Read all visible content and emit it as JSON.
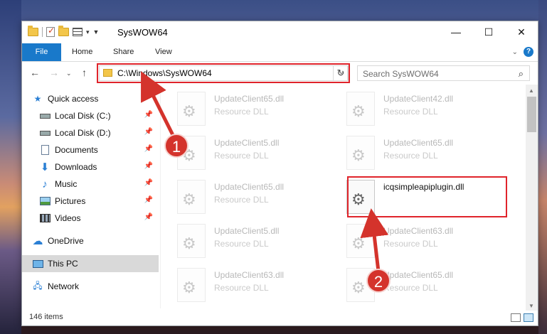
{
  "window": {
    "title": "SysWOW64",
    "minimize": "—",
    "maximize": "☐",
    "close": "✕"
  },
  "ribbon": {
    "tabs": [
      "File",
      "Home",
      "Share",
      "View"
    ],
    "expand_icon": "chevron-down-icon",
    "help": "?"
  },
  "address": {
    "path": "C:\\Windows\\SysWOW64",
    "search_placeholder": "Search SysWOW64"
  },
  "sidebar": {
    "items": [
      {
        "label": "Quick access",
        "icon": "star-icon"
      },
      {
        "label": "Local Disk (C:)",
        "icon": "drive-icon"
      },
      {
        "label": "Local Disk (D:)",
        "icon": "drive-icon"
      },
      {
        "label": "Documents",
        "icon": "documents-icon"
      },
      {
        "label": "Downloads",
        "icon": "downloads-icon"
      },
      {
        "label": "Music",
        "icon": "music-icon"
      },
      {
        "label": "Pictures",
        "icon": "pictures-icon"
      },
      {
        "label": "Videos",
        "icon": "videos-icon"
      },
      {
        "label": "OneDrive",
        "icon": "cloud-icon"
      },
      {
        "label": "This PC",
        "icon": "computer-icon"
      },
      {
        "label": "Network",
        "icon": "network-icon"
      }
    ]
  },
  "files": [
    {
      "name": "UpdateClient65.dll",
      "desc": "Resource DLL"
    },
    {
      "name": "UpdateClient42.dll",
      "desc": "Resource DLL"
    },
    {
      "name": "UpdateClient5.dll",
      "desc": "Resource DLL"
    },
    {
      "name": "UpdateClient65.dll",
      "desc": "Resource DLL"
    },
    {
      "name": "UpdateClient65.dll",
      "desc": "Resource DLL"
    },
    {
      "name": "icqsimpleapiplugin.dll",
      "desc": ""
    },
    {
      "name": "UpdateClient5.dll",
      "desc": "Resource DLL"
    },
    {
      "name": "UpdateClient63.dll",
      "desc": "Resource DLL"
    },
    {
      "name": "UpdateClient63.dll",
      "desc": "Resource DLL"
    },
    {
      "name": "UpdateClient65.dll",
      "desc": "Resource DLL"
    }
  ],
  "status": {
    "item_count": "146 items"
  },
  "callouts": [
    "1",
    "2"
  ],
  "colors": {
    "accent": "#1979ca",
    "highlight": "#e0242b",
    "callout": "#d4332c"
  }
}
